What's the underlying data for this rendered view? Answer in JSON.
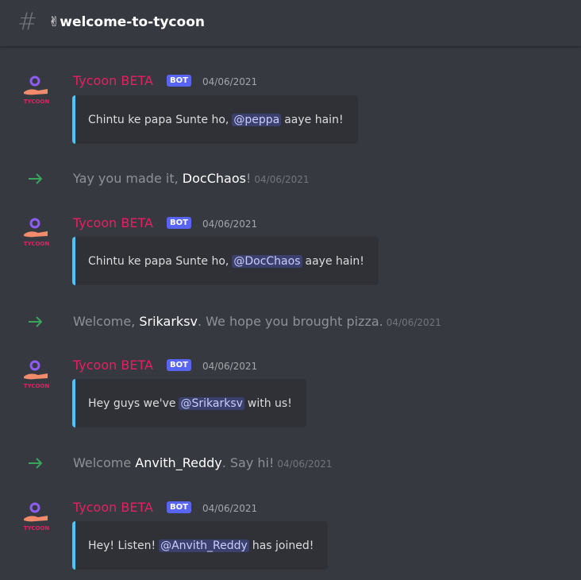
{
  "header": {
    "hash_icon": "#",
    "channel": "✌welcome-to-tycoon"
  },
  "bot": {
    "name": "Tycoon BETA",
    "tag": "BOT",
    "avatar_text": "TYCOON",
    "accent_color": "#e91e63",
    "embed_color": "#4fc3f7"
  },
  "messages": [
    {
      "ts": "04/06/2021",
      "pre": "Chintu ke papa Sunte ho,",
      "mention": "@peppa",
      "post": "aaye hain!"
    },
    {
      "ts": "04/06/2021",
      "pre": "Chintu ke papa Sunte ho,",
      "mention": "@DocChaos",
      "post": "aaye hain!"
    },
    {
      "ts": "04/06/2021",
      "pre": "Hey guys we've",
      "mention": "@Srikarksv",
      "post": "with us!"
    },
    {
      "ts": "04/06/2021",
      "pre": "Hey! Listen!",
      "mention": "@Anvith_Reddy",
      "post": "has joined!"
    }
  ],
  "joins": [
    {
      "pre": "Yay you made it,",
      "user": "DocChaos",
      "post": "!",
      "ts": "04/06/2021"
    },
    {
      "pre": "Welcome,",
      "user": "Srikarksv",
      "post": ". We hope you brought pizza.",
      "ts": "04/06/2021"
    },
    {
      "pre": "Welcome",
      "user": "Anvith_Reddy",
      "post": ". Say hi!",
      "ts": "04/06/2021"
    }
  ]
}
